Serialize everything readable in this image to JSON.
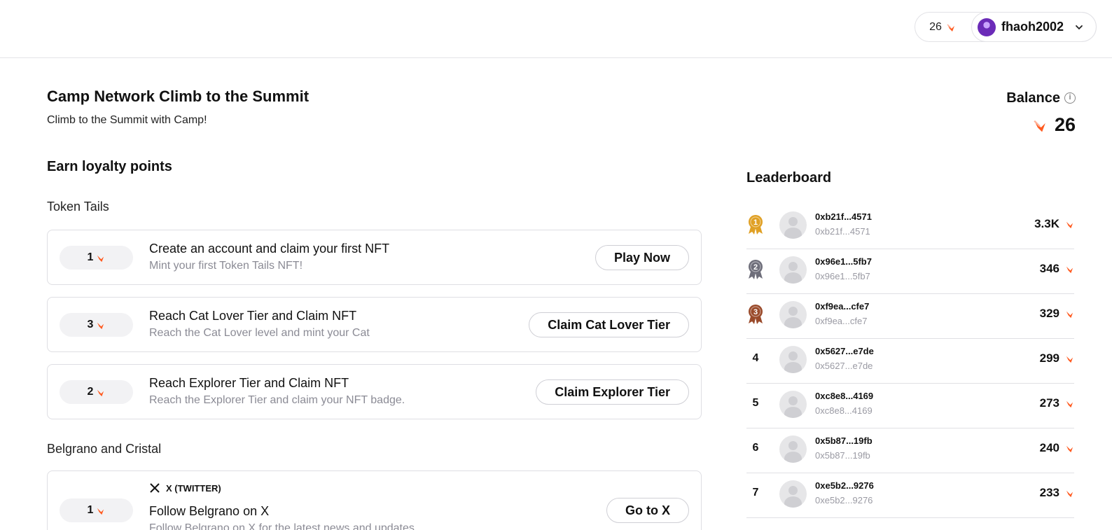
{
  "header": {
    "points": "26",
    "username": "fhaoh2002"
  },
  "page": {
    "title": "Camp Network Climb to the Summit",
    "subtitle": "Climb to the Summit with Camp!"
  },
  "balance": {
    "label": "Balance",
    "value": "26"
  },
  "earn": {
    "title": "Earn loyalty points",
    "groups": [
      {
        "title": "Token Tails",
        "tasks": [
          {
            "points": "1",
            "title": "Create an account and claim your first NFT",
            "desc": "Mint your first Token Tails NFT!",
            "button": "Play Now"
          },
          {
            "points": "3",
            "title": "Reach Cat Lover Tier and Claim NFT",
            "desc": "Reach the Cat Lover level and mint your Cat",
            "button": "Claim Cat Lover Tier"
          },
          {
            "points": "2",
            "title": "Reach Explorer Tier and Claim NFT",
            "desc": "Reach the Explorer Tier and claim your NFT badge.",
            "button": "Claim Explorer Tier"
          }
        ]
      },
      {
        "title": "Belgrano and Cristal",
        "tasks": [
          {
            "platform": "X (TWITTER)",
            "points": "1",
            "title": "Follow Belgrano on X",
            "desc": "Follow Belgrano on X for the latest news and updates",
            "button": "Go to X"
          }
        ]
      }
    ]
  },
  "leaderboard": {
    "title": "Leaderboard",
    "rows": [
      {
        "rank": "1",
        "name": "0xb21f...4571",
        "sub": "0xb21f...4571",
        "score": "3.3K",
        "medal": "gold"
      },
      {
        "rank": "2",
        "name": "0x96e1...5fb7",
        "sub": "0x96e1...5fb7",
        "score": "346",
        "medal": "silver"
      },
      {
        "rank": "3",
        "name": "0xf9ea...cfe7",
        "sub": "0xf9ea...cfe7",
        "score": "329",
        "medal": "bronze"
      },
      {
        "rank": "4",
        "name": "0x5627...e7de",
        "sub": "0x5627...e7de",
        "score": "299"
      },
      {
        "rank": "5",
        "name": "0xc8e8...4169",
        "sub": "0xc8e8...4169",
        "score": "273"
      },
      {
        "rank": "6",
        "name": "0x5b87...19fb",
        "sub": "0x5b87...19fb",
        "score": "240"
      },
      {
        "rank": "7",
        "name": "0xe5b2...9276",
        "sub": "0xe5b2...9276",
        "score": "233"
      }
    ]
  },
  "colors": {
    "accent_flame": "#ff5a1f",
    "gold": "#e0a024",
    "silver": "#6e6e7a",
    "bronze": "#9a4a2a"
  }
}
